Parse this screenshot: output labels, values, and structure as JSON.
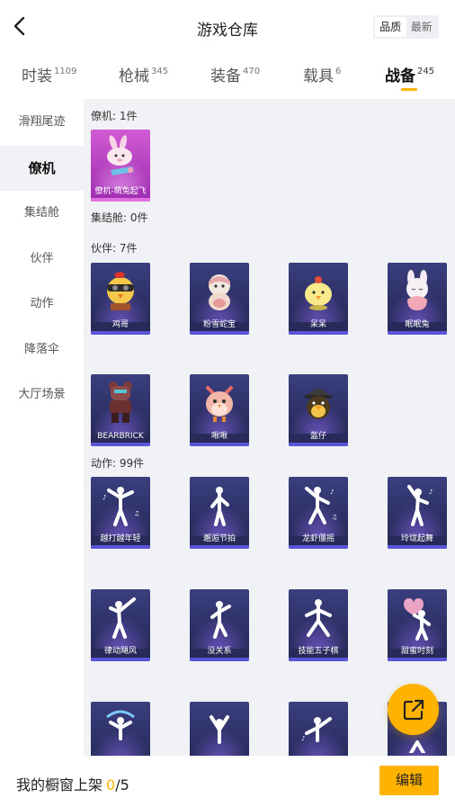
{
  "header": {
    "title": "游戏仓库",
    "sort": [
      "品质",
      "最新"
    ],
    "sort_active": 0
  },
  "tabs": [
    {
      "label": "时装",
      "count": "1109"
    },
    {
      "label": "枪械",
      "count": "345"
    },
    {
      "label": "装备",
      "count": "470"
    },
    {
      "label": "载具",
      "count": "6"
    },
    {
      "label": "战备",
      "count": "245"
    }
  ],
  "active_tab": 4,
  "sidebar": [
    "滑翔尾迹",
    "僚机",
    "集结舱",
    "伙伴",
    "动作",
    "降落伞",
    "大厅场景"
  ],
  "active_side": 1,
  "sections": {
    "wingman": {
      "title": "僚机: 1件",
      "items": [
        "僚机-萌兔起飞"
      ]
    },
    "pod": {
      "title": "集结舱: 0件"
    },
    "partner": {
      "title": "伙伴: 7件",
      "items": [
        "鸡哥",
        "粉雪蛇宝",
        "呆呆",
        "眠眠兔",
        "BEARBRICK",
        "啾啾",
        "盔仔"
      ]
    },
    "emote": {
      "title": "动作: 99件",
      "items": [
        "越打越年轻",
        "邂逅节拍",
        "龙虾僵摇",
        "玲珑起舞",
        "律动飓风",
        "没关系",
        "技能五子棋",
        "甜蜜时刻"
      ]
    }
  },
  "bottom": {
    "prefix": "我的橱窗上架",
    "current": "0",
    "sep": "/5",
    "edit": "编辑"
  },
  "colors": {
    "accent": "#ffb300",
    "card": "#2c2f63",
    "wingman_card": "#b33fc0",
    "content_bg": "#f0f2f5"
  },
  "icons": {
    "back": "chevron-left-icon",
    "share": "share-external-icon"
  }
}
